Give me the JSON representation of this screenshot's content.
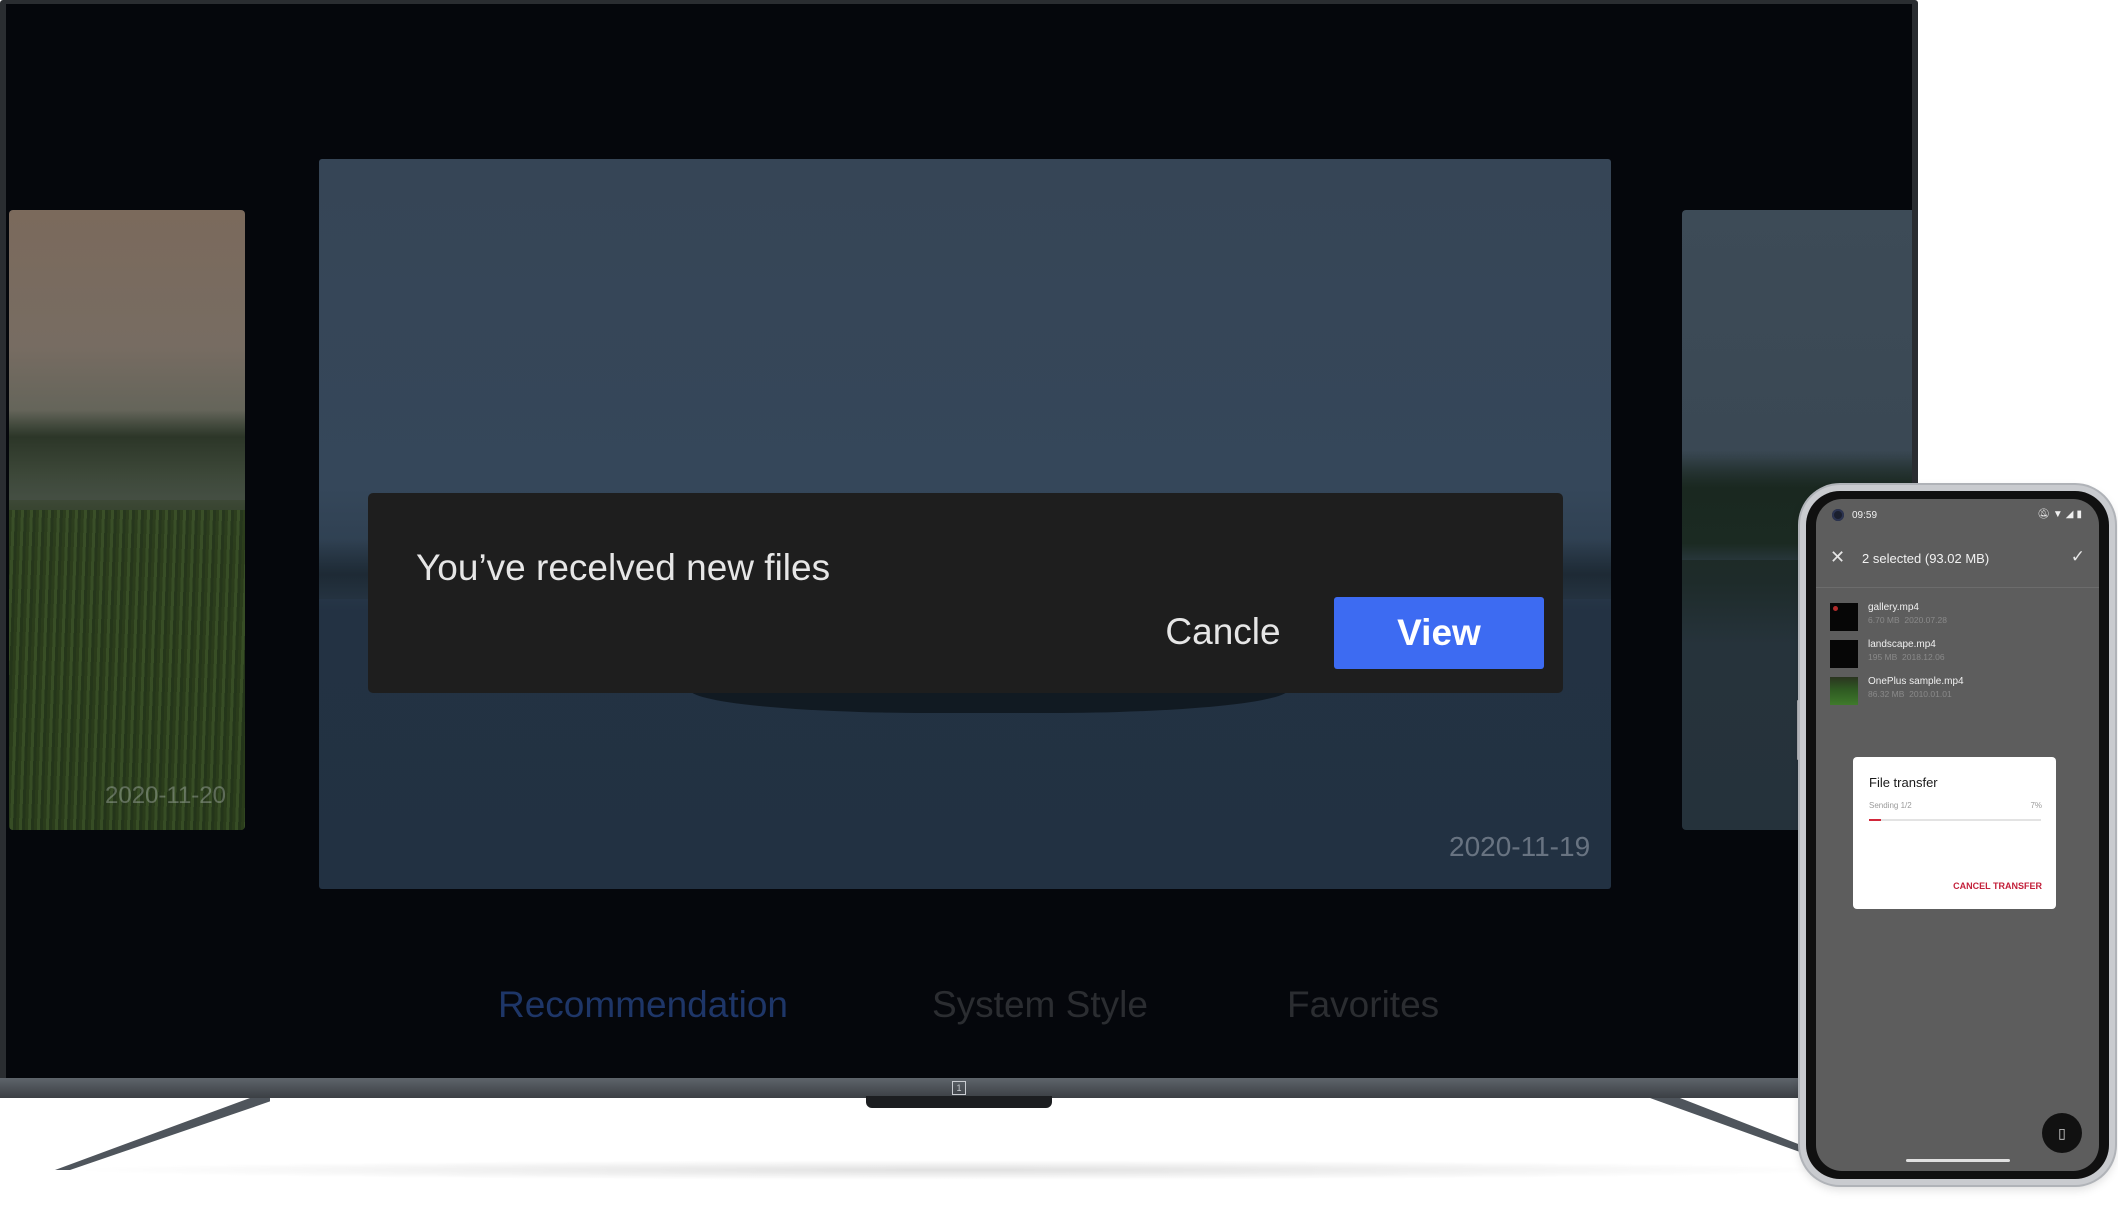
{
  "tv": {
    "dialog": {
      "message": "You’ve recelved new files",
      "cancel_label": "Cancle",
      "view_label": "View"
    },
    "photos": {
      "left_date": "2020-11-20",
      "main_date": "2020-11-19"
    },
    "tabs": [
      {
        "label": "Recommendation",
        "selected": true
      },
      {
        "label": "System Style",
        "selected": false
      },
      {
        "label": "Favorites",
        "selected": false
      }
    ],
    "colors": {
      "accent": "#3d6bf2",
      "selected_tab": "#1e3668"
    }
  },
  "phone": {
    "status": {
      "time": "09:59"
    },
    "selection": {
      "title": "2 selected (93.02 MB)"
    },
    "files": [
      {
        "name": "gallery.mp4",
        "size": "6.70 MB",
        "date": "2020.07.28",
        "thumb": "dark-red-dot"
      },
      {
        "name": "landscape.mp4",
        "size": "195 MB",
        "date": "2018.12.06",
        "thumb": "black"
      },
      {
        "name": "OnePlus sample.mp4",
        "size": "86.32 MB",
        "date": "2010.01.01",
        "thumb": "green-field"
      }
    ],
    "transfer_dialog": {
      "title": "File transfer",
      "status": "Sending 1/2",
      "percent_label": "7%",
      "progress": 0.07,
      "cancel_label": "CANCEL TRANSFER"
    },
    "colors": {
      "progress": "#d2263a"
    }
  }
}
